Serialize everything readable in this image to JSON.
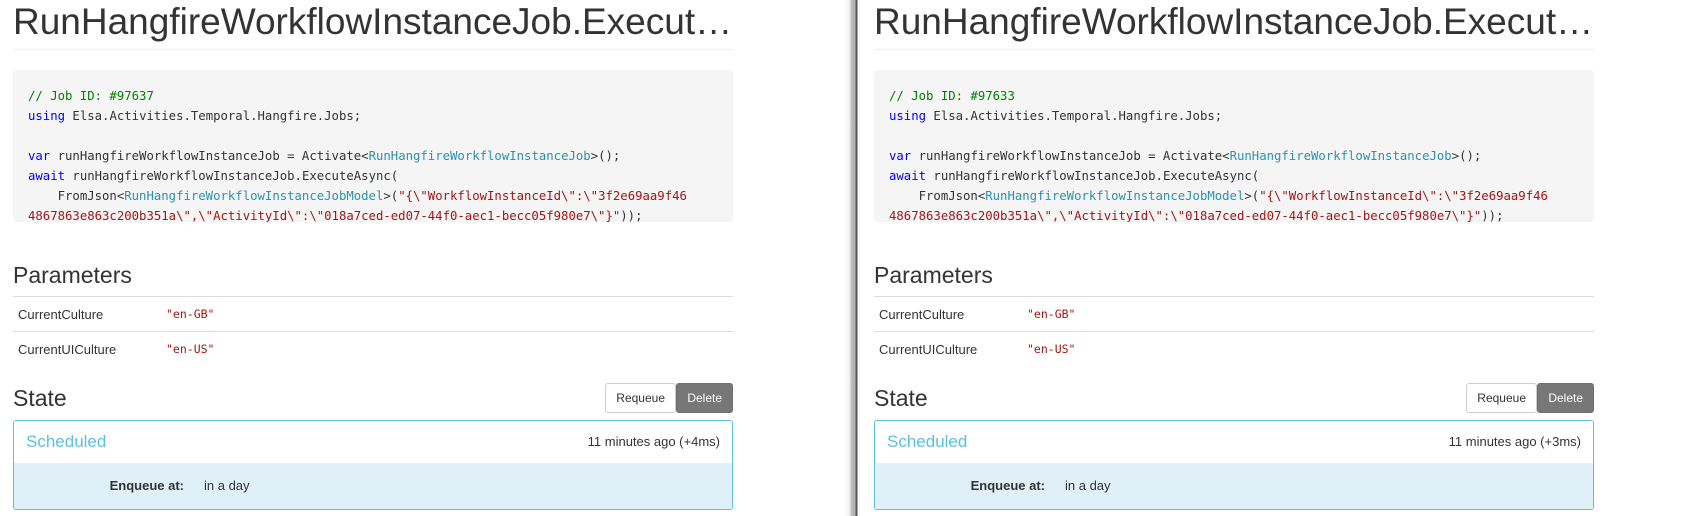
{
  "panes": [
    {
      "title": "RunHangfireWorkflowInstanceJob.ExecuteAsync",
      "code": {
        "comment": "// Job ID: #97637",
        "using_kw": "using",
        "using_ns": " Elsa.Activities.Temporal.Hangfire.Jobs;",
        "var_kw": "var",
        "var_decl": " runHangfireWorkflowInstanceJob = Activate<",
        "job_type": "RunHangfireWorkflowInstanceJob",
        "activate_tail": ">();",
        "await_kw": "await",
        "await_call": " runHangfireWorkflowInstanceJob.ExecuteAsync(",
        "fromjson_lead": "    FromJson<",
        "model_type": "RunHangfireWorkflowInstanceJobModel",
        "fromjson_mid": ">(",
        "json_line1": "\"{\\\"WorkflowInstanceId\\\":\\\"3f2e69aa9f46",
        "json_line2": "4867863e863c200b351a\\\",\\\"ActivityId\\\":\\\"018a7ced-ed07-44f0-aec1-becc05f980e7\\\"}\"",
        "closing": "));"
      },
      "parameters_heading": "Parameters",
      "parameters": [
        {
          "name": "CurrentCulture",
          "value": "\"en-GB\""
        },
        {
          "name": "CurrentUICulture",
          "value": "\"en-US\""
        }
      ],
      "state_heading": "State",
      "requeue_label": "Requeue",
      "delete_label": "Delete",
      "state": {
        "name": "Scheduled",
        "time": "11 minutes ago (+4ms)",
        "key": "Enqueue at:",
        "value": "in a day"
      }
    },
    {
      "title": "RunHangfireWorkflowInstanceJob.ExecuteAsync",
      "code": {
        "comment": "// Job ID: #97633",
        "using_kw": "using",
        "using_ns": " Elsa.Activities.Temporal.Hangfire.Jobs;",
        "var_kw": "var",
        "var_decl": " runHangfireWorkflowInstanceJob = Activate<",
        "job_type": "RunHangfireWorkflowInstanceJob",
        "activate_tail": ">();",
        "await_kw": "await",
        "await_call": " runHangfireWorkflowInstanceJob.ExecuteAsync(",
        "fromjson_lead": "    FromJson<",
        "model_type": "RunHangfireWorkflowInstanceJobModel",
        "fromjson_mid": ">(",
        "json_line1": "\"{\\\"WorkflowInstanceId\\\":\\\"3f2e69aa9f46",
        "json_line2": "4867863e863c200b351a\\\",\\\"ActivityId\\\":\\\"018a7ced-ed07-44f0-aec1-becc05f980e7\\\"}\"",
        "closing": "));"
      },
      "parameters_heading": "Parameters",
      "parameters": [
        {
          "name": "CurrentCulture",
          "value": "\"en-GB\""
        },
        {
          "name": "CurrentUICulture",
          "value": "\"en-US\""
        }
      ],
      "state_heading": "State",
      "requeue_label": "Requeue",
      "delete_label": "Delete",
      "state": {
        "name": "Scheduled",
        "time": "11 minutes ago (+3ms)",
        "key": "Enqueue at:",
        "value": "in a day"
      }
    }
  ],
  "colors": {
    "state_accent": "#5bc0de",
    "state_body_bg": "#dff0f8",
    "code_bg": "#f5f5f5",
    "code_comment": "#008000",
    "code_keyword": "#0000ff",
    "code_type": "#2b91af",
    "code_string": "#a31515",
    "delete_button_bg": "#777777"
  }
}
